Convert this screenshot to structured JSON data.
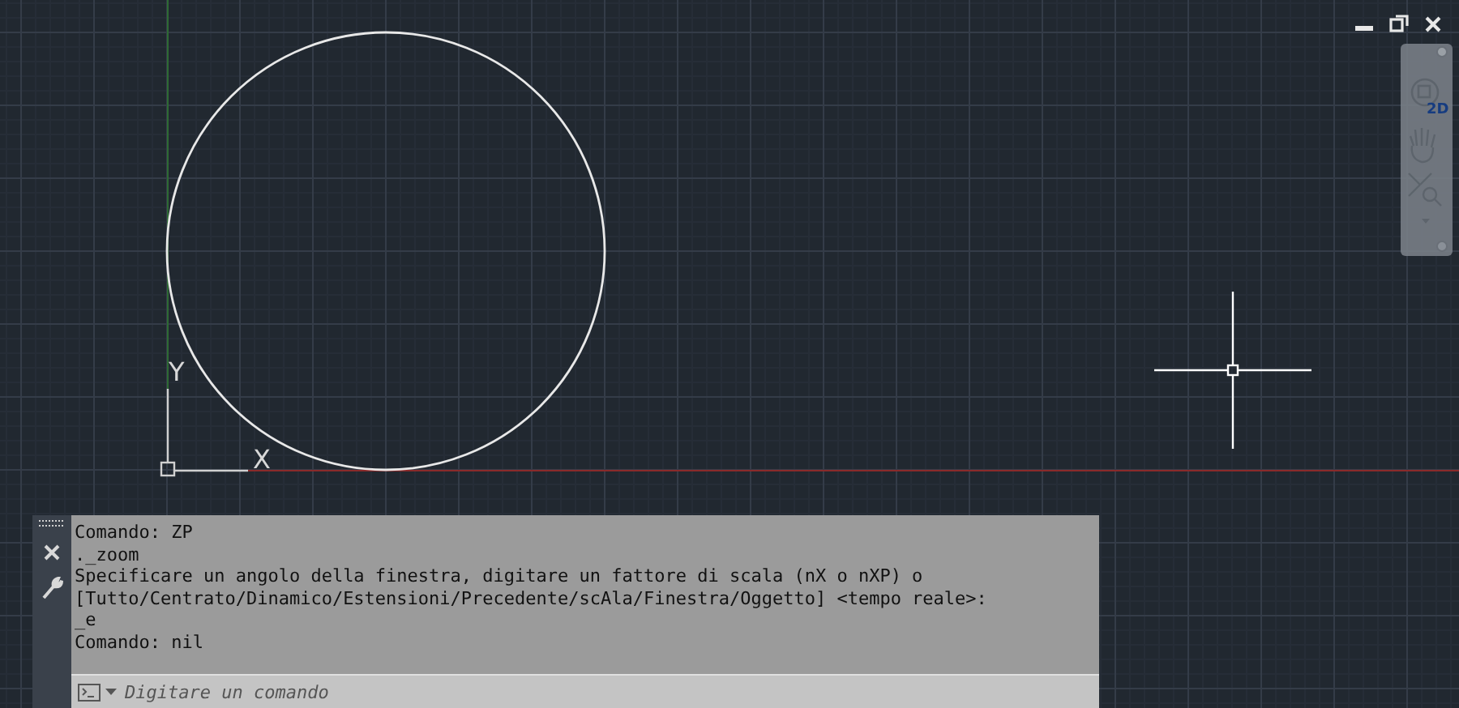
{
  "ucs": {
    "x_label": "X",
    "y_label": "Y"
  },
  "navigation_bar": {
    "view_cube_label": "2D"
  },
  "command_line": {
    "history": [
      "Comando: ZP",
      "._zoom",
      "Specificare un angolo della finestra, digitare un fattore di scala (nX o nXP) o",
      "[Tutto/Centrato/Dinamico/Estensioni/Precedente/scAla/Finestra/Oggetto] <tempo reale>:",
      "_e",
      "Comando: nil"
    ],
    "input": {
      "placeholder": "Digitare un comando"
    }
  }
}
